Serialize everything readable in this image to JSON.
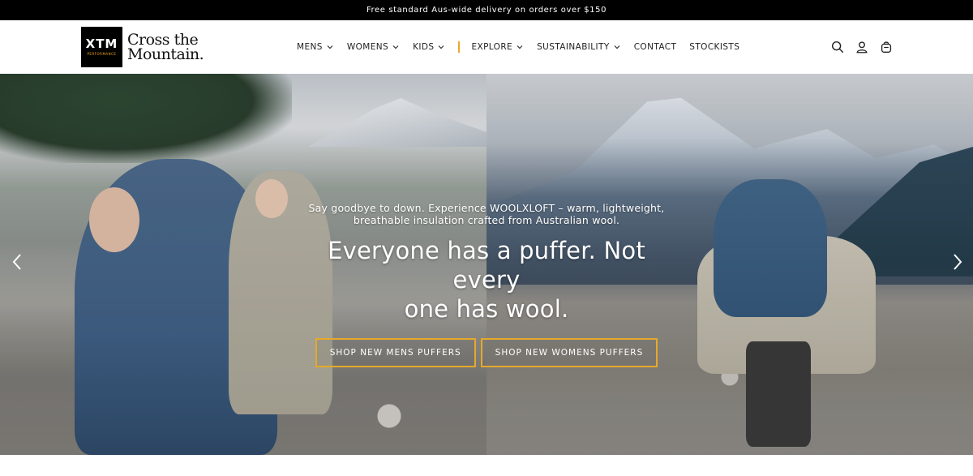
{
  "announcement": "Free standard Aus-wide delivery on orders over $150",
  "brand": {
    "mark": "XTM",
    "sub": "PERFORMANCE",
    "line1": "Cross the",
    "line2": "Mountain."
  },
  "nav": {
    "items": [
      {
        "label": "MENS",
        "has_dropdown": true
      },
      {
        "label": "WOMENS",
        "has_dropdown": true
      },
      {
        "label": "KIDS",
        "has_dropdown": true
      },
      {
        "label": "EXPLORE",
        "has_dropdown": true
      },
      {
        "label": "SUSTAINABILITY",
        "has_dropdown": true
      },
      {
        "label": "CONTACT",
        "has_dropdown": false
      },
      {
        "label": "STOCKISTS",
        "has_dropdown": false
      }
    ]
  },
  "header_icons": [
    "search-icon",
    "account-icon",
    "cart-icon"
  ],
  "hero": {
    "subtitle_line1": "Say goodbye to down. Experience WOOLXLOFT – warm, lightweight,",
    "subtitle_line2": "breathable insulation crafted from Australian wool.",
    "title_line1": "Everyone has a puffer. Not every",
    "title_line2": "one has wool.",
    "button_mens": "SHOP NEW MENS PUFFERS",
    "button_womens": "SHOP NEW WOMENS PUFFERS"
  },
  "colors": {
    "accent": "#e6a92b",
    "announcement_bg": "#000000",
    "header_bg": "#ffffff"
  }
}
